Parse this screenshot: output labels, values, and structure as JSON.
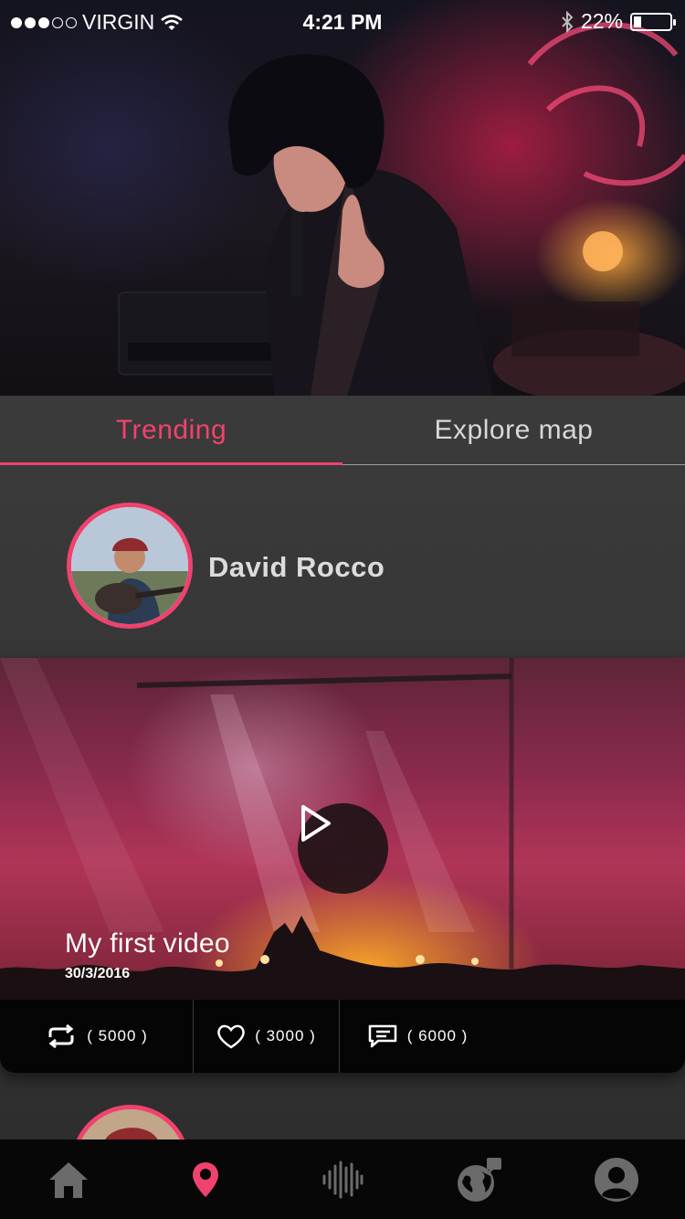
{
  "status_bar": {
    "carrier": "VIRGIN",
    "signal_dots_filled": 3,
    "signal_dots_total": 5,
    "time": "4:21 PM",
    "battery": "22%",
    "battery_level": 0.22
  },
  "tabs": [
    {
      "label": "Trending",
      "active": true
    },
    {
      "label": "Explore map",
      "active": false
    }
  ],
  "colors": {
    "accent": "#f0426e",
    "panel": "#3a3a3a",
    "nav_bg": "#070707"
  },
  "feed": {
    "author": {
      "name": "David Rocco"
    },
    "post": {
      "title": "My first video",
      "date": "30/3/2016",
      "stats": {
        "reposts": "( 5000 )",
        "likes": "( 3000 )",
        "comments": "( 6000 )"
      }
    }
  },
  "bottom_nav": [
    {
      "icon": "home-icon",
      "active": false
    },
    {
      "icon": "location-pin-icon",
      "active": true
    },
    {
      "icon": "sound-wave-icon",
      "active": false
    },
    {
      "icon": "globe-chat-icon",
      "active": false
    },
    {
      "icon": "profile-icon",
      "active": false
    }
  ]
}
